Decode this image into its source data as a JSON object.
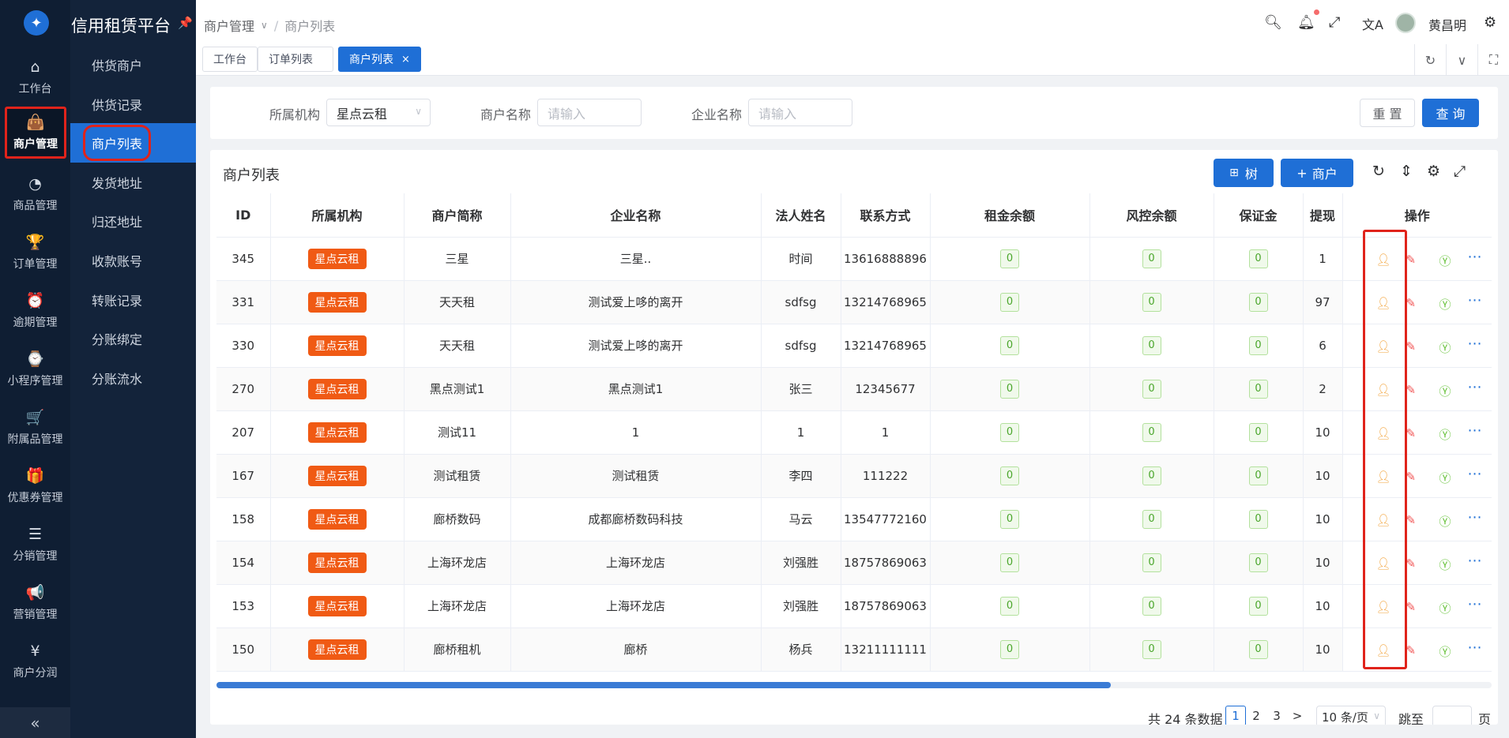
{
  "app": {
    "title": "信用租赁平台"
  },
  "rail": {
    "items": [
      {
        "label": "工作台",
        "icon": "home-icon",
        "glyph": "⌂"
      },
      {
        "label": "商户管理",
        "icon": "shopping-bag-icon",
        "glyph": "👜"
      },
      {
        "label": "商品管理",
        "icon": "apple-icon",
        "glyph": "◔"
      },
      {
        "label": "订单管理",
        "icon": "trophy-icon",
        "glyph": "🏆"
      },
      {
        "label": "逾期管理",
        "icon": "alarm-icon",
        "glyph": "⏰"
      },
      {
        "label": "小程序管理",
        "icon": "watch-icon",
        "glyph": "⌚"
      },
      {
        "label": "附属品管理",
        "icon": "cart-icon",
        "glyph": "🛒"
      },
      {
        "label": "优惠券管理",
        "icon": "gift-icon",
        "glyph": "🎁"
      },
      {
        "label": "分销管理",
        "icon": "sliders-icon",
        "glyph": "☰"
      },
      {
        "label": "营销管理",
        "icon": "megaphone-icon",
        "glyph": "📢"
      },
      {
        "label": "商户分润",
        "icon": "yuan-circle-icon",
        "glyph": "¥"
      }
    ],
    "collapse_glyph": "«"
  },
  "submenu": {
    "items": [
      "供货商户",
      "供货记录",
      "商户列表",
      "发货地址",
      "归还地址",
      "收款账号",
      "转账记录",
      "分账绑定",
      "分账流水"
    ]
  },
  "header": {
    "breadcrumb": [
      "商户管理",
      "商户列表"
    ],
    "user": "黄昌明"
  },
  "tabs": [
    "工作台",
    "订单列表",
    "商户列表"
  ],
  "filter": {
    "org_label": "所属机构",
    "org_value": "星点云租",
    "merchant_label": "商户名称",
    "merchant_placeholder": "请输入",
    "company_label": "企业名称",
    "company_placeholder": "请输入",
    "reset": "重 置",
    "search": "查 询"
  },
  "card": {
    "title": "商户列表",
    "tree_btn": "树",
    "add_btn": "商户"
  },
  "table": {
    "columns": [
      "ID",
      "所属机构",
      "商户简称",
      "企业名称",
      "法人姓名",
      "联系方式",
      "租金余额",
      "风控余额",
      "保证金",
      "提现",
      "操作"
    ],
    "rows": [
      {
        "id": "345",
        "org": "星点云租",
        "short": "三星",
        "company": "三星..",
        "legal": "时间",
        "phone": "13616888896",
        "rent": "0",
        "risk": "0",
        "deposit": "0",
        "withdraw": "1"
      },
      {
        "id": "331",
        "org": "星点云租",
        "short": "天天租",
        "company": "测试爱上哆的离开",
        "legal": "sdfsg",
        "phone": "13214768965",
        "rent": "0",
        "risk": "0",
        "deposit": "0",
        "withdraw": "97"
      },
      {
        "id": "330",
        "org": "星点云租",
        "short": "天天租",
        "company": "测试爱上哆的离开",
        "legal": "sdfsg",
        "phone": "13214768965",
        "rent": "0",
        "risk": "0",
        "deposit": "0",
        "withdraw": "6"
      },
      {
        "id": "270",
        "org": "星点云租",
        "short": "黑点测试1",
        "company": "黑点测试1",
        "legal": "张三",
        "phone": "12345677",
        "rent": "0",
        "risk": "0",
        "deposit": "0",
        "withdraw": "2"
      },
      {
        "id": "207",
        "org": "星点云租",
        "short": "测试11",
        "company": "1",
        "legal": "1",
        "phone": "1",
        "rent": "0",
        "risk": "0",
        "deposit": "0",
        "withdraw": "10"
      },
      {
        "id": "167",
        "org": "星点云租",
        "short": "测试租赁",
        "company": "测试租赁",
        "legal": "李四",
        "phone": "111222",
        "rent": "0",
        "risk": "0",
        "deposit": "0",
        "withdraw": "10"
      },
      {
        "id": "158",
        "org": "星点云租",
        "short": "廊桥数码",
        "company": "成都廊桥数码科技",
        "legal": "马云",
        "phone": "13547772160",
        "rent": "0",
        "risk": "0",
        "deposit": "0",
        "withdraw": "10"
      },
      {
        "id": "154",
        "org": "星点云租",
        "short": "上海环龙店",
        "company": "上海环龙店",
        "legal": "刘强胜",
        "phone": "18757869063",
        "rent": "0",
        "risk": "0",
        "deposit": "0",
        "withdraw": "10"
      },
      {
        "id": "153",
        "org": "星点云租",
        "short": "上海环龙店",
        "company": "上海环龙店",
        "legal": "刘强胜",
        "phone": "18757869063",
        "rent": "0",
        "risk": "0",
        "deposit": "0",
        "withdraw": "10"
      },
      {
        "id": "150",
        "org": "星点云租",
        "short": "廊桥租机",
        "company": "廊桥",
        "legal": "杨兵",
        "phone": "13211111111",
        "rent": "0",
        "risk": "0",
        "deposit": "0",
        "withdraw": "10"
      }
    ]
  },
  "pager": {
    "total": "共 24 条数据",
    "pages": [
      "1",
      "2",
      "3"
    ],
    "next": ">",
    "size": "10 条/页",
    "jump_label": "跳至",
    "page_unit": "页"
  },
  "colors": {
    "accent": "#1f6fd6",
    "org_tag": "#f05a14",
    "highlight": "#e0231b"
  }
}
